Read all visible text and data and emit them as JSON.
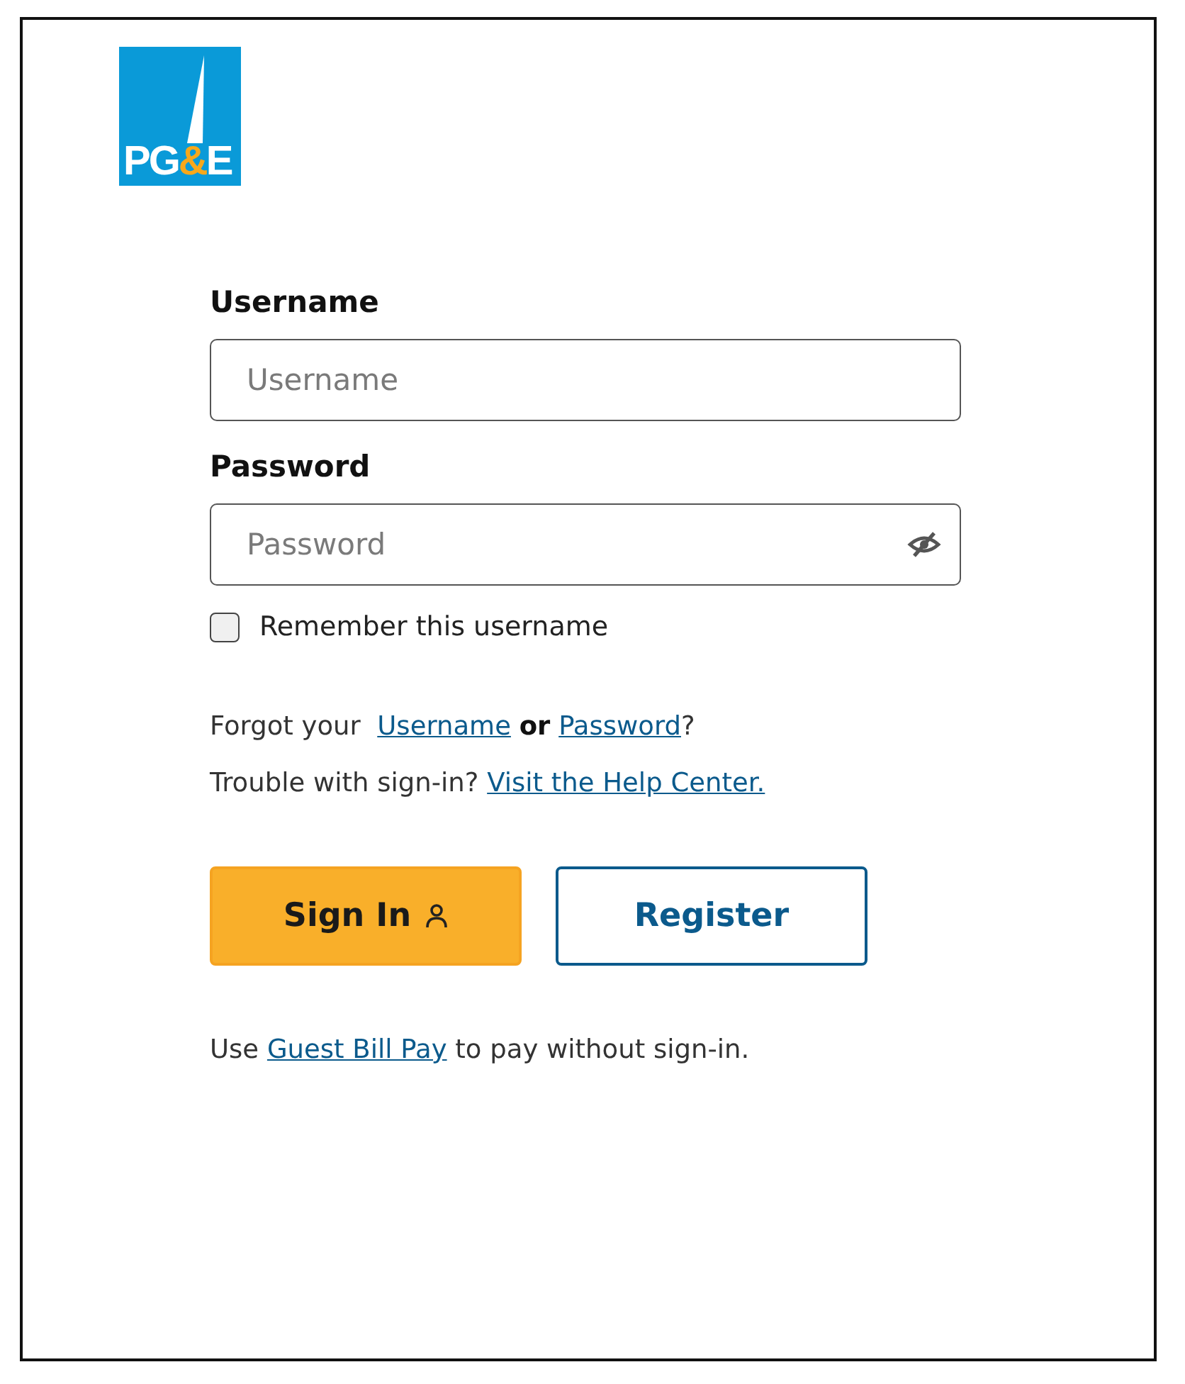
{
  "logo": {
    "parts": [
      {
        "text": "PG",
        "color": "#ffffff"
      },
      {
        "text": "&",
        "color": "#f7a81b"
      },
      {
        "text": "E",
        "color": "#ffffff"
      }
    ]
  },
  "fields": [
    {
      "label": "Username",
      "placeholder": "Username",
      "kind": "text"
    },
    {
      "label": "Password",
      "placeholder": "Password",
      "kind": "password"
    }
  ],
  "remember": {
    "label": "Remember this username",
    "checked": false
  },
  "forgot": {
    "prefix": "Forgot your",
    "link_1": "Username",
    "joiner": "or",
    "link_2": "Password",
    "suffix": "?"
  },
  "trouble": {
    "prefix": "Trouble with sign-in?",
    "link": "Visit the Help Center."
  },
  "buttons": [
    {
      "label": "Sign In",
      "kind": "primary"
    },
    {
      "label": "Register",
      "kind": "secondary"
    }
  ],
  "guest": {
    "prefix": "Use",
    "link": "Guest Bill Pay",
    "suffix": "to pay without sign-in."
  }
}
